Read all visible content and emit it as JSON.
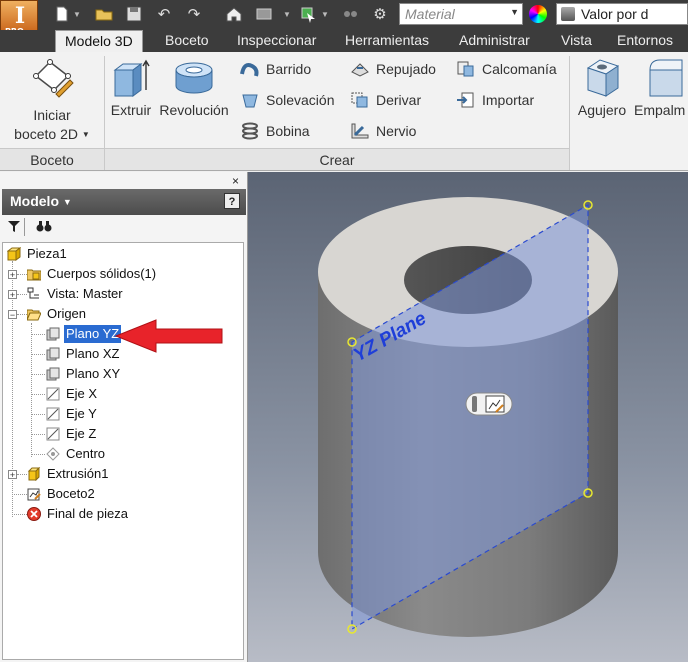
{
  "app": {
    "button_letter": "I",
    "edition": "PRO"
  },
  "quick_access": {
    "material_placeholder": "Material",
    "appearance_value": "Valor por d"
  },
  "tabs": [
    {
      "label": "Modelo 3D",
      "active": true
    },
    {
      "label": "Boceto"
    },
    {
      "label": "Inspeccionar"
    },
    {
      "label": "Herramientas"
    },
    {
      "label": "Administrar"
    },
    {
      "label": "Vista"
    },
    {
      "label": "Entornos"
    }
  ],
  "ribbon": {
    "panels": {
      "boceto": "Boceto",
      "crear": "Crear"
    },
    "buttons": {
      "iniciar_boceto_line1": "Iniciar",
      "iniciar_boceto_line2": "boceto 2D",
      "extruir": "Extruir",
      "revolucion": "Revolución",
      "barrido": "Barrido",
      "solevacion": "Solevación",
      "bobina": "Bobina",
      "repujado": "Repujado",
      "derivar": "Derivar",
      "nervio": "Nervio",
      "calcomania": "Calcomanía",
      "importar": "Importar",
      "agujero": "Agujero",
      "empalme": "Empalm"
    }
  },
  "browser": {
    "title": "Modelo",
    "help": "?",
    "close": "×",
    "tree": {
      "root": "Pieza1",
      "cuerpos": "Cuerpos sólidos(1)",
      "vista": "Vista: Master",
      "origen": "Origen",
      "plano_yz": "Plano YZ",
      "plano_xz": "Plano XZ",
      "plano_xy": "Plano XY",
      "eje_x": "Eje X",
      "eje_y": "Eje Y",
      "eje_z": "Eje Z",
      "centro": "Centro",
      "extrusion": "Extrusión1",
      "boceto2": "Boceto2",
      "final": "Final de pieza"
    }
  },
  "viewport": {
    "plane_label": "YZ Plane"
  },
  "colors": {
    "selection": "#2a6bd1",
    "annotation_arrow": "#e8232a",
    "plane_fill": "#7f98d8",
    "title_bar": "#3c3c3c"
  }
}
